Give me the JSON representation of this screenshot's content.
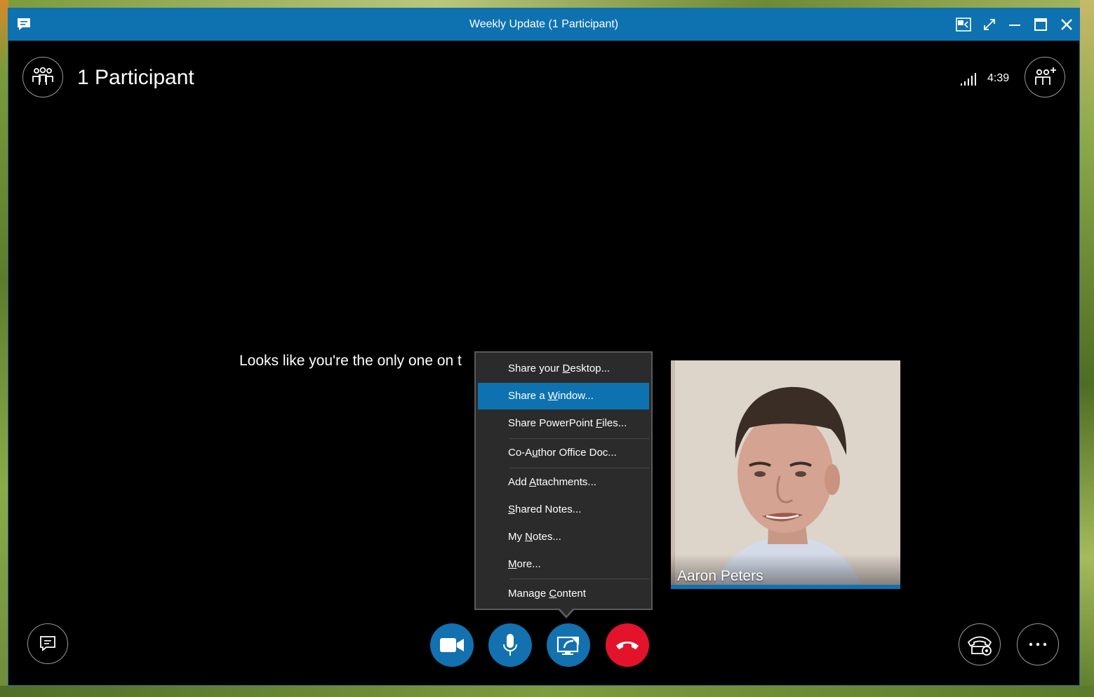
{
  "window": {
    "title": "Weekly Update (1 Participant)"
  },
  "titlebar_buttons": [
    "compact-view-icon",
    "fullscreen-icon",
    "minimize-icon",
    "maximize-icon",
    "close-icon"
  ],
  "header": {
    "participants_label": "1 Participant",
    "call_timer": "4:39"
  },
  "stage": {
    "alone_message": "Looks like you're the only one on t"
  },
  "video": {
    "participant_name": "Aaron Peters"
  },
  "share_menu": {
    "items": [
      {
        "pre": "Share your ",
        "key": "D",
        "post": "esktop..."
      },
      {
        "pre": "Share a ",
        "key": "W",
        "post": "indow..."
      },
      {
        "pre": "Share PowerPoint ",
        "key": "F",
        "post": "iles..."
      },
      {
        "pre": "Co-A",
        "key": "u",
        "post": "thor Office Doc..."
      },
      {
        "pre": "Add ",
        "key": "A",
        "post": "ttachments..."
      },
      {
        "pre": "",
        "key": "S",
        "post": "hared Notes..."
      },
      {
        "pre": "My ",
        "key": "N",
        "post": "otes..."
      },
      {
        "pre": "",
        "key": "M",
        "post": "ore..."
      },
      {
        "pre": "Manage ",
        "key": "C",
        "post": "ontent"
      }
    ],
    "highlighted_index": 1
  },
  "colors": {
    "titlebar": "#0f72b0",
    "control_blue": "#1271ae",
    "hangup_red": "#e3132c",
    "menu_bg": "#2b2b2b",
    "menu_highlight": "#0f72b0"
  }
}
